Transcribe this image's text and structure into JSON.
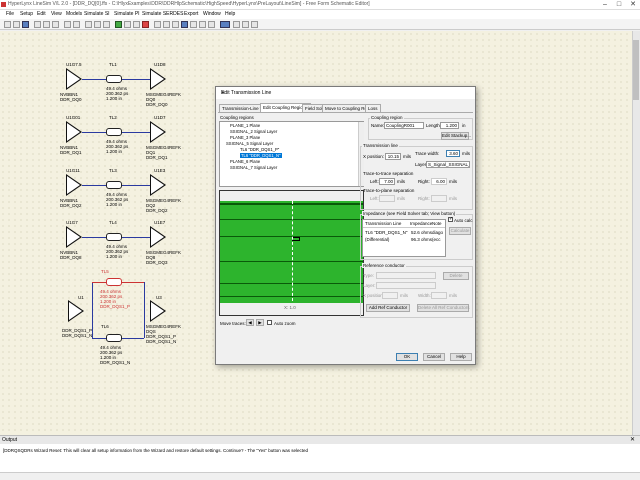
{
  "window": {
    "title": "HyperLynx LineSim V/L 2.0 - [DDR_DQ[0].ffs - C:\\HlyxExamples\\DDR\\DDRHlpSchematic\\HighSpeed\\HyperLynx\\PreLayout\\LineSim] - Free Form Schematic Editor]",
    "min": "–",
    "max": "□",
    "close": "✕"
  },
  "menu": [
    "File",
    "Setup",
    "Edit",
    "View",
    "Models",
    "Simulate SI",
    "Simulate PI",
    "Simulate SERDES",
    "Export",
    "Window",
    "Help"
  ],
  "schematic": {
    "row1": {
      "tx": "U1G7.5",
      "tx_sub": [
        "NVBBN1",
        "DDR_DQ0"
      ],
      "tl": "TL1",
      "tl_sub": [
        "49.4 ohms",
        "200.362 ps",
        "1.200 in"
      ],
      "rx": "U1D8",
      "rx_sub": [
        "MSGMEG4REFK",
        "DQ0",
        "DDR_DQ0"
      ]
    },
    "row2": {
      "tx": "U1G01",
      "tx_sub": [
        "NVBBN1",
        "DDR_DQ1"
      ],
      "tl": "TL2",
      "tl_sub": [
        "49.4 ohms",
        "200.362 ps",
        "1.200 in"
      ],
      "rx": "U1D7",
      "rx_sub": [
        "MSGMEG4REFK",
        "DQ1",
        "DDR_DQ1"
      ]
    },
    "row3": {
      "tx": "U1G11",
      "tx_sub": [
        "NVBBN1",
        "DDR_DQ2"
      ],
      "tl": "TL3",
      "tl_sub": [
        "49.4 ohms",
        "200.362 ps",
        "1.200 in"
      ],
      "rx": "U1E3",
      "rx_sub": [
        "MSGMEG4REFK",
        "DQ2",
        "DDR_DQ2"
      ]
    },
    "row4": {
      "tx": "U1G7",
      "tx_sub": [
        "NVBBN1",
        "DDR_DQ8"
      ],
      "tl": "TL4",
      "tl_sub": [
        "49.4 ohms",
        "200.362 ps",
        "1.200 in"
      ],
      "rx": "U1E7",
      "rx_sub": [
        "MSGMEG4REFK",
        "DQ8",
        "DDR_DQ3"
      ]
    },
    "row5": {
      "tx": "U1",
      "tx_sub": [
        "DDR_DQS1_P",
        "DDR_DQS1_N"
      ],
      "tl_top": "TL5",
      "tl_top_sub": [
        "49.4 ohms",
        "200.362 ps",
        "1.200 in",
        "DDR_DQS1_P"
      ],
      "tl_bot": "TL6",
      "tl_bot_sub": [
        "49.4 ohms",
        "200.362 ps",
        "1.200 in",
        "DDR_DQS1_N"
      ],
      "rx": "U3",
      "rx_sub": [
        "MSGMEG4REFK",
        "DQS",
        "DDR_DQS1_P",
        "DDR_DQS1_N"
      ]
    }
  },
  "dialog": {
    "title": "Edit Transmission Line",
    "close": "✕",
    "tabs": [
      "Transmission-Line Type",
      "Edit Coupling Regions",
      "Field Solver",
      "Move to Coupling Region",
      "Loss"
    ],
    "coupling_regions_label": "Coupling regions",
    "tree": [
      "PLANE_1 Plane",
      "SSIGNAL_2 Signal Layer",
      "PLANE_3 Plane",
      "SSIGNAL_5 Signal Layer",
      "TL6 \"DDR_DQS1_P\"",
      "TL6 \"DDR_DQS1_N\"",
      "PLANE_6 Plane",
      "SSIGNAL_7 Signal Layer"
    ],
    "coupling_region": {
      "group": "Coupling region",
      "name_label": "Name:",
      "name_value": "CouplingR001",
      "length_label": "Length:",
      "length_value": "1.200",
      "length_unit": "in",
      "edit_stackup": "Edit Stackup..."
    },
    "transmission_line": {
      "group": "Transmission line",
      "xpos_label": "X position:",
      "xpos_value": "10.15",
      "xpos_unit": "mils",
      "trace_width_label": "Trace width:",
      "trace_width_value": "3.60",
      "trace_width_unit": "mils",
      "layer_label": "Layer:",
      "layer_value": "S_Signal_SSIGNAL_5",
      "t2t_label": "Trace-to-trace separation",
      "left_label": "Left:",
      "left_value": "7.00",
      "left_unit": "mils",
      "right_label": "Right:",
      "right_value": "6.00",
      "right_unit": "mils",
      "t2p_label": "Trace-to-plane separation",
      "left2_label": "Left:",
      "left2_unit": "mils",
      "right2_label": "Right:",
      "right2_unit": "mils"
    },
    "impedance": {
      "group": "Impedance (see Field Solver tab; View button)",
      "autocalc": "Auto calc",
      "col_tl": "Transmission Line",
      "col_imp": "Impedance",
      "col_note": "Note",
      "calculate": "Calculate",
      "rows": [
        {
          "tl": "TL6 \"DDR_DQS1_N\"",
          "imp": "52.6 ohms",
          "note": "diago"
        },
        {
          "tl": "(Differential)",
          "imp": "96.3 ohms",
          "note": "(ecc"
        }
      ]
    },
    "reference": {
      "group": "Reference conductor",
      "type_label": "Type:",
      "layer_label": "Layer:",
      "xpos_label": "X position:",
      "xpos_unit": "mils",
      "width_label": "Width:",
      "width_unit": "mils",
      "delete": "Delete",
      "add": "Add Ref Conductor",
      "delete_all": "Delete All Ref Conductors"
    },
    "xscale_label": "X: 1.0",
    "move_traces_label": "Move traces:",
    "auto_zoom": "Auto zoom",
    "ok": "OK",
    "cancel": "Cancel",
    "help": "Help"
  },
  "output": {
    "title": "Output",
    "close": "✕",
    "line": "[DDRQSQDRs Wizard Reset: This will clear all setup information from the Wizard and restore default settings. Continue? - The \"Yes\" button was selected"
  },
  "colors": {
    "pcb_green": "#1a9a1a",
    "dielectric": "#2db42d",
    "selection": "#0078d7",
    "wire": "#2a3aa0",
    "diff": "#cc3333"
  }
}
